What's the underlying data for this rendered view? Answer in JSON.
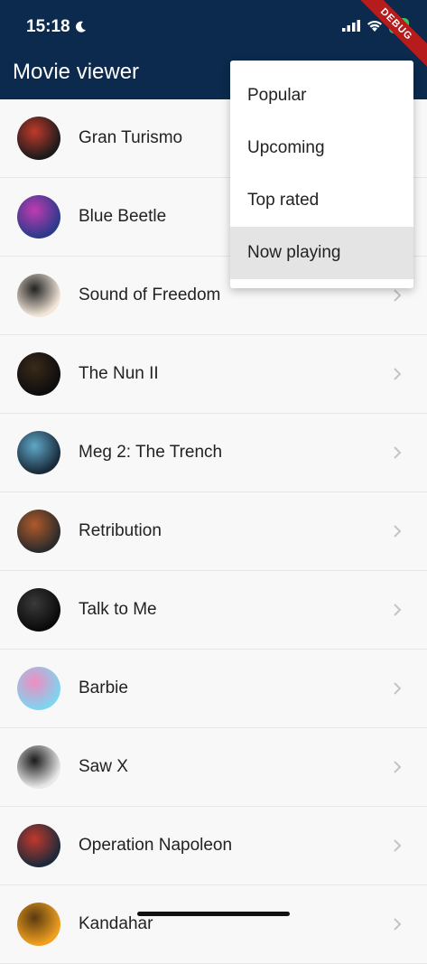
{
  "status_bar": {
    "time": "15:18",
    "battery": "45"
  },
  "debug_banner": "DEBUG",
  "app_bar": {
    "title": "Movie viewer"
  },
  "menu": {
    "items": [
      {
        "label": "Popular",
        "selected": false
      },
      {
        "label": "Upcoming",
        "selected": false
      },
      {
        "label": "Top rated",
        "selected": false
      },
      {
        "label": "Now playing",
        "selected": true
      }
    ]
  },
  "movies": [
    {
      "title": "Gran Turismo",
      "colors": [
        "#1b1b1b",
        "#c0392b"
      ]
    },
    {
      "title": "Blue Beetle",
      "colors": [
        "#2b3a8c",
        "#c03bb0"
      ]
    },
    {
      "title": "Sound of Freedom",
      "colors": [
        "#f2e6d8",
        "#222222"
      ]
    },
    {
      "title": "The Nun II",
      "colors": [
        "#0d0d0d",
        "#3a2a1a"
      ]
    },
    {
      "title": "Meg 2: The Trench",
      "colors": [
        "#1a2a3a",
        "#5fa8c8"
      ]
    },
    {
      "title": "Retribution",
      "colors": [
        "#2b2b2b",
        "#b05a2a"
      ]
    },
    {
      "title": "Talk to Me",
      "colors": [
        "#0a0a0a",
        "#3a3a3a"
      ]
    },
    {
      "title": "Barbie",
      "colors": [
        "#7fd4ef",
        "#f08cc0"
      ]
    },
    {
      "title": "Saw X",
      "colors": [
        "#e8e8e8",
        "#1a1a1a"
      ]
    },
    {
      "title": "Operation Napoleon",
      "colors": [
        "#1e2a3a",
        "#c0392b"
      ]
    },
    {
      "title": "Kandahar",
      "colors": [
        "#f0a020",
        "#5a3a10"
      ]
    }
  ]
}
